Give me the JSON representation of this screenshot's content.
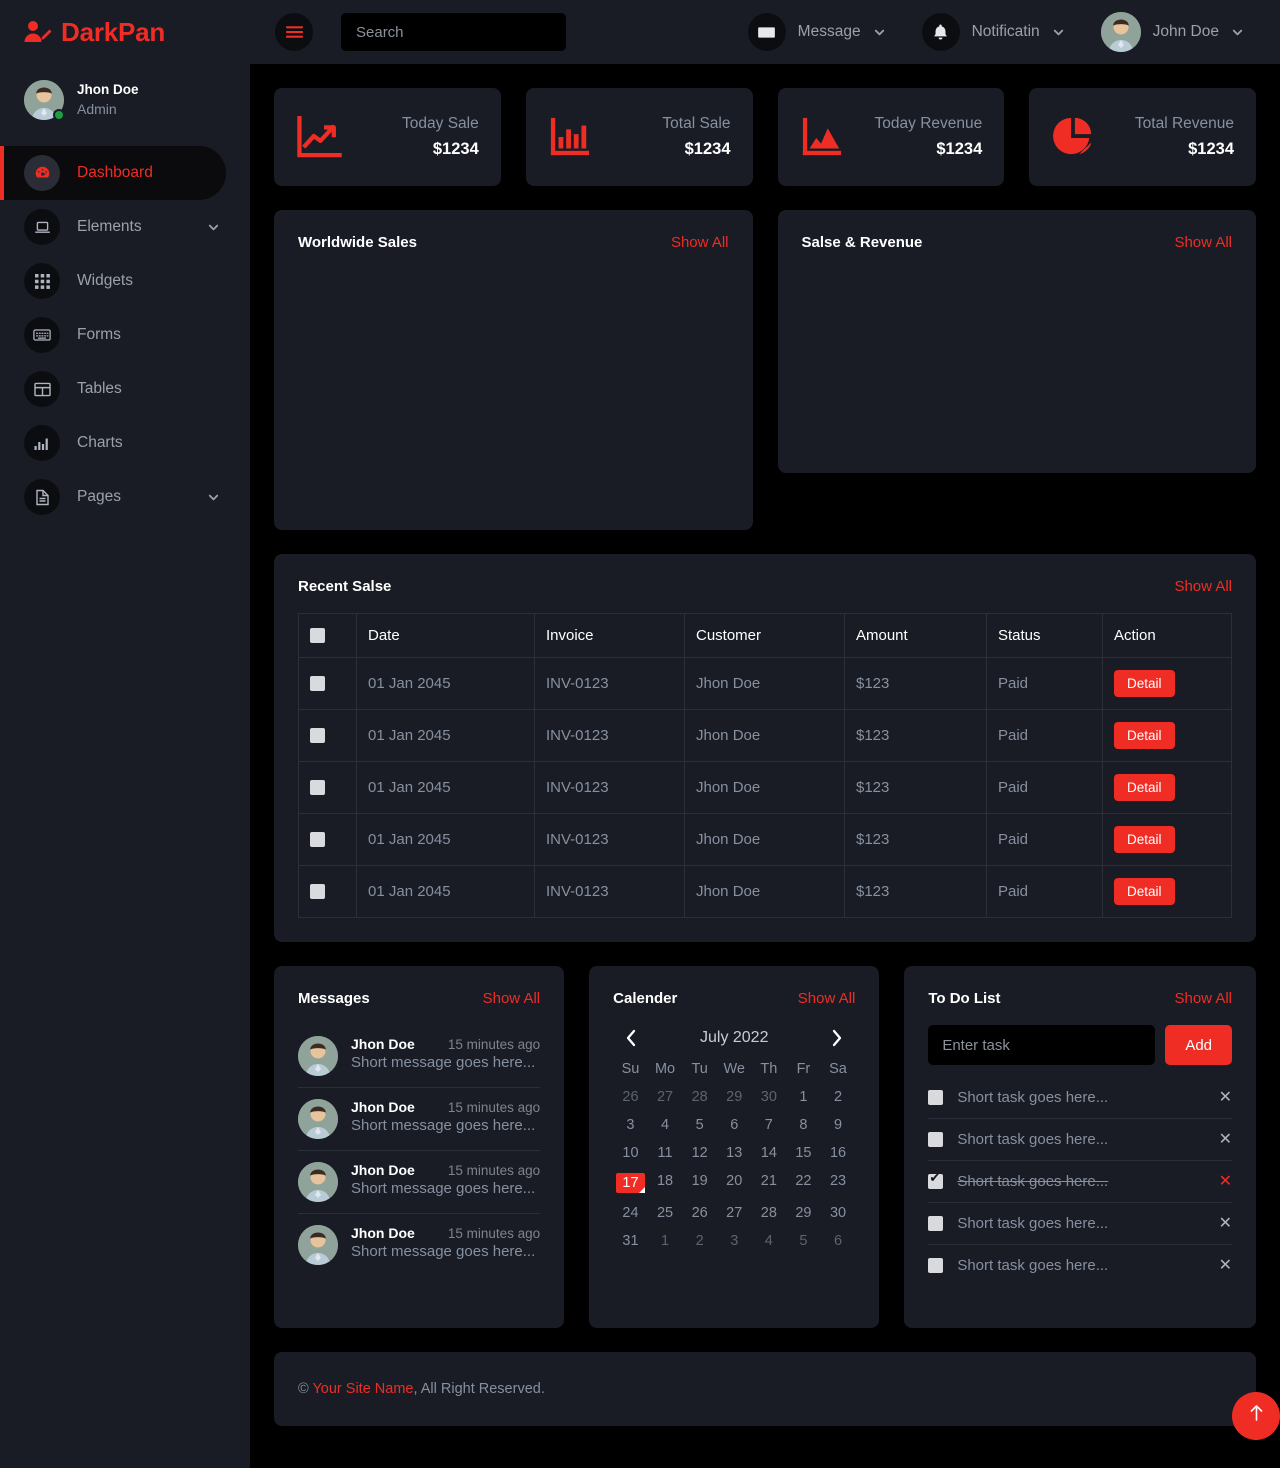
{
  "brand": {
    "name": "DarkPan",
    "icon": "user-edit-icon"
  },
  "sidebar": {
    "profile": {
      "name": "Jhon Doe",
      "role": "Admin",
      "avatar": "user-avatar",
      "status": "online"
    },
    "items": [
      {
        "label": "Dashboard",
        "icon": "tachometer-icon",
        "active": true,
        "caret": false
      },
      {
        "label": "Elements",
        "icon": "laptop-icon",
        "active": false,
        "caret": true
      },
      {
        "label": "Widgets",
        "icon": "th-icon",
        "active": false,
        "caret": false
      },
      {
        "label": "Forms",
        "icon": "keyboard-icon",
        "active": false,
        "caret": false
      },
      {
        "label": "Tables",
        "icon": "table-icon",
        "active": false,
        "caret": false
      },
      {
        "label": "Charts",
        "icon": "chart-bar-icon",
        "active": false,
        "caret": false
      },
      {
        "label": "Pages",
        "icon": "file-icon",
        "active": false,
        "caret": true
      }
    ]
  },
  "topbar": {
    "menu_toggle": "bars-icon",
    "search": {
      "placeholder": "Search",
      "value": ""
    },
    "message": {
      "label": "Message",
      "icon": "envelope-icon"
    },
    "notification": {
      "label": "Notificatin",
      "icon": "bell-icon"
    },
    "user": {
      "label": "John Doe",
      "avatar": "user-avatar"
    }
  },
  "stats": [
    {
      "label": "Today Sale",
      "value": "$1234",
      "icon": "chart-line-icon"
    },
    {
      "label": "Total Sale",
      "value": "$1234",
      "icon": "chart-bar-icon"
    },
    {
      "label": "Today Revenue",
      "value": "$1234",
      "icon": "chart-area-icon"
    },
    {
      "label": "Total Revenue",
      "value": "$1234",
      "icon": "chart-pie-icon"
    }
  ],
  "charts": {
    "worldwide_sales": {
      "title": "Worldwide Sales",
      "show_all": "Show All"
    },
    "sales_revenue": {
      "title": "Salse & Revenue",
      "show_all": "Show All"
    }
  },
  "recent_sales": {
    "title": "Recent Salse",
    "show_all": "Show All",
    "columns": [
      "",
      "Date",
      "Invoice",
      "Customer",
      "Amount",
      "Status",
      "Action"
    ],
    "rows": [
      {
        "checked": false,
        "date": "01 Jan 2045",
        "invoice": "INV-0123",
        "customer": "Jhon Doe",
        "amount": "$123",
        "status": "Paid",
        "action": "Detail"
      },
      {
        "checked": false,
        "date": "01 Jan 2045",
        "invoice": "INV-0123",
        "customer": "Jhon Doe",
        "amount": "$123",
        "status": "Paid",
        "action": "Detail"
      },
      {
        "checked": false,
        "date": "01 Jan 2045",
        "invoice": "INV-0123",
        "customer": "Jhon Doe",
        "amount": "$123",
        "status": "Paid",
        "action": "Detail"
      },
      {
        "checked": false,
        "date": "01 Jan 2045",
        "invoice": "INV-0123",
        "customer": "Jhon Doe",
        "amount": "$123",
        "status": "Paid",
        "action": "Detail"
      },
      {
        "checked": false,
        "date": "01 Jan 2045",
        "invoice": "INV-0123",
        "customer": "Jhon Doe",
        "amount": "$123",
        "status": "Paid",
        "action": "Detail"
      }
    ]
  },
  "messages": {
    "title": "Messages",
    "show_all": "Show All",
    "items": [
      {
        "name": "Jhon Doe",
        "time": "15 minutes ago",
        "text": "Short message goes here..."
      },
      {
        "name": "Jhon Doe",
        "time": "15 minutes ago",
        "text": "Short message goes here..."
      },
      {
        "name": "Jhon Doe",
        "time": "15 minutes ago",
        "text": "Short message goes here..."
      },
      {
        "name": "Jhon Doe",
        "time": "15 minutes ago",
        "text": "Short message goes here..."
      }
    ]
  },
  "calendar": {
    "title": "Calender",
    "show_all": "Show All",
    "month": "July 2022",
    "prev": "chevron-left-icon",
    "next": "chevron-right-icon",
    "dow": [
      "Su",
      "Mo",
      "Tu",
      "We",
      "Th",
      "Fr",
      "Sa"
    ],
    "weeks": [
      [
        {
          "d": "26",
          "muted": true
        },
        {
          "d": "27",
          "muted": true
        },
        {
          "d": "28",
          "muted": true
        },
        {
          "d": "29",
          "muted": true
        },
        {
          "d": "30",
          "muted": true
        },
        {
          "d": "1"
        },
        {
          "d": "2"
        }
      ],
      [
        {
          "d": "3"
        },
        {
          "d": "4"
        },
        {
          "d": "5"
        },
        {
          "d": "6"
        },
        {
          "d": "7"
        },
        {
          "d": "8"
        },
        {
          "d": "9"
        }
      ],
      [
        {
          "d": "10"
        },
        {
          "d": "11"
        },
        {
          "d": "12"
        },
        {
          "d": "13"
        },
        {
          "d": "14"
        },
        {
          "d": "15"
        },
        {
          "d": "16"
        }
      ],
      [
        {
          "d": "17",
          "today": true
        },
        {
          "d": "18"
        },
        {
          "d": "19"
        },
        {
          "d": "20"
        },
        {
          "d": "21"
        },
        {
          "d": "22"
        },
        {
          "d": "23"
        }
      ],
      [
        {
          "d": "24"
        },
        {
          "d": "25"
        },
        {
          "d": "26"
        },
        {
          "d": "27"
        },
        {
          "d": "28"
        },
        {
          "d": "29"
        },
        {
          "d": "30"
        }
      ],
      [
        {
          "d": "31"
        },
        {
          "d": "1",
          "muted": true
        },
        {
          "d": "2",
          "muted": true
        },
        {
          "d": "3",
          "muted": true
        },
        {
          "d": "4",
          "muted": true
        },
        {
          "d": "5",
          "muted": true
        },
        {
          "d": "6",
          "muted": true
        }
      ]
    ]
  },
  "todo": {
    "title": "To Do List",
    "show_all": "Show All",
    "input_placeholder": "Enter task",
    "input_value": "",
    "add_label": "Add",
    "items": [
      {
        "text": "Short task goes here...",
        "done": false,
        "remove": "times-icon"
      },
      {
        "text": "Short task goes here...",
        "done": false,
        "remove": "times-icon"
      },
      {
        "text": "Short task goes here...",
        "done": true,
        "remove": "times-icon"
      },
      {
        "text": "Short task goes here...",
        "done": false,
        "remove": "times-icon"
      },
      {
        "text": "Short task goes here...",
        "done": false,
        "remove": "times-icon"
      }
    ]
  },
  "footer": {
    "copyright_symbol": "© ",
    "site_name": "Your Site Name",
    "rest": ", All Right Reserved.",
    "back_to_top": "arrow-up-icon"
  },
  "colors": {
    "accent": "#EF2D24",
    "panel": "#191C24",
    "background": "#000000",
    "muted_text": "#8790A0",
    "online": "#1A9E3F"
  }
}
